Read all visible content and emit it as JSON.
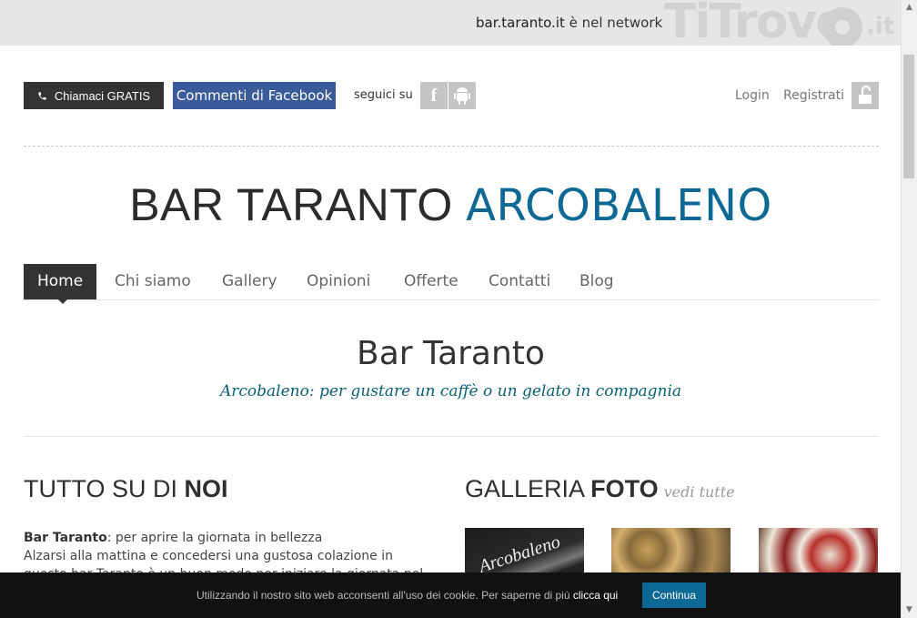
{
  "topbar": {
    "domain": "bar.taranto.it",
    "network_text": "è nel network",
    "logo_text": "TiTrovo",
    "logo_suffix": ".it"
  },
  "header": {
    "call_button": "Chiamaci GRATIS",
    "facebook_button": "Commenti di Facebook",
    "follow_text": "seguici su",
    "login": "Login",
    "register": "Registrati"
  },
  "brand": {
    "title_part1": "BAR TARANTO",
    "title_part2": "ARCOBALENO",
    "accent_color": "#0e6894"
  },
  "nav": {
    "items": [
      "Home",
      "Chi siamo",
      "Gallery",
      "Opinioni",
      "Offerte",
      "Contatti",
      "Blog"
    ],
    "active": "Home"
  },
  "hero": {
    "title": "Bar Taranto",
    "tagline": "Arcobaleno: per gustare un caffè o un gelato in compagnia"
  },
  "about": {
    "heading_light": "TUTTO SU DI",
    "heading_bold": "NOI",
    "lead_bold": "Bar Taranto",
    "lead_rest": ": per aprire la giornata in bellezza",
    "body": "Alzarsi alla mattina e concedersi una gustosa colazione in questo bar Taranto è un buon modo per iniziare la giornata nel migliore"
  },
  "gallery": {
    "heading_light": "GALLERIA",
    "heading_bold": "FOTO",
    "see_all": "vedi tutte",
    "thumb1_text": "Arcobaleno"
  },
  "cookie": {
    "message": "Utilizzando il nostro sito web acconsenti all'uso dei cookie. Per saperne di più",
    "link": "clicca qui",
    "button": "Continua"
  }
}
